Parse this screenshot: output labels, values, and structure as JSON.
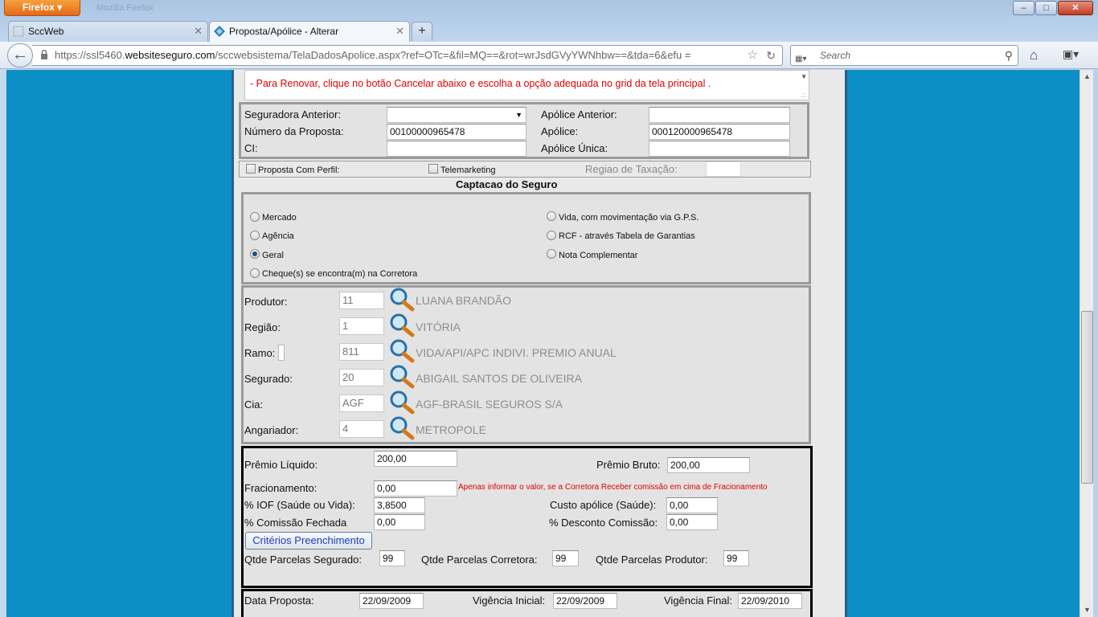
{
  "browser": {
    "app_button": "Firefox",
    "window_title": "Mozilla Firefox",
    "tabs": [
      {
        "label": "SccWeb",
        "active": false
      },
      {
        "label": "Proposta/Apólice - Alterar",
        "active": true
      }
    ],
    "new_tab": "+",
    "url_prefix": "https://ssl5460.",
    "url_domain": "websiteseguro.com",
    "url_path": "/sccwebsistema/TelaDadosApolice.aspx?ref=OTc=&fil=MQ==&rot=wrJsdGVyYWNhbw==&tda=6&efu =",
    "search_placeholder": "Search",
    "window_controls": {
      "minimize": "–",
      "maximize": "□",
      "close": "✕"
    }
  },
  "notice": {
    "text": "- Para Renovar, clique no botão Cancelar abaixo e escolha a opção adequada  no grid da tela principal ."
  },
  "policy": {
    "seguradora_anterior_label": "Seguradora Anterior:",
    "seguradora_anterior_value": "",
    "apolice_anterior_label": "Apólice Anterior:",
    "apolice_anterior_value": "",
    "numero_proposta_label": "Número da Proposta:",
    "numero_proposta_value": "00100000965478",
    "apolice_label": "Apólice:",
    "apolice_value": "000120000965478",
    "ci_label": "CI:",
    "ci_value": "",
    "apolice_unica_label": "Apólice Única:",
    "apolice_unica_value": ""
  },
  "flags": {
    "perfil_label": "Proposta Com Perfil:",
    "perfil_checked": false,
    "telemarketing_label": "Telemarketing",
    "telemarketing_checked": false,
    "regiao_label": "Regiao de Taxação:",
    "regiao_value": ""
  },
  "captacao": {
    "title": "Captacao do Seguro",
    "options": [
      {
        "label": "Mercado",
        "selected": false
      },
      {
        "label": "Agência",
        "selected": false
      },
      {
        "label": "Geral",
        "selected": true
      },
      {
        "label": "Cheque(s) se encontra(m) na Corretora",
        "selected": false
      },
      {
        "label": "Vida, com movimentação via G.P.S.",
        "selected": false
      },
      {
        "label": "RCF - através Tabela de Garantias",
        "selected": false
      },
      {
        "label": "Nota Complementar",
        "selected": false
      }
    ]
  },
  "lookups": [
    {
      "label": "Produtor:",
      "code": "11",
      "name": "LUANA BRANDÃO"
    },
    {
      "label": "Região:",
      "code": "1",
      "name": "VITÓRIA"
    },
    {
      "label": "Ramo:",
      "code": "811",
      "name": "VIDA/API/APC INDIVI. PREMIO ANUAL"
    },
    {
      "label": "Segurado:",
      "code": "20",
      "name": "ABIGAIL SANTOS DE OLIVEIRA"
    },
    {
      "label": "Cia:",
      "code": "AGF",
      "name": "AGF-BRASIL SEGUROS S/A"
    },
    {
      "label": "Angariador:",
      "code": "4",
      "name": "METROPOLE"
    }
  ],
  "premios": {
    "premio_liquido_label": "Prêmio Líquido:",
    "premio_liquido_value": "200,00",
    "premio_bruto_label": "Prêmio Bruto:",
    "premio_bruto_value": "200,00",
    "fracionamento_label": "Fracionamento:",
    "fracionamento_value": "0,00",
    "fracionamento_hint": "Apenas informar o valor, se a Corretora Receber comissão em cima de Fracionamento",
    "iof_label": "% IOF (Saúde ou Vida):",
    "iof_value": "3,8500",
    "custo_label": "Custo apólice (Saúde):",
    "custo_value": "0,00",
    "comissao_label": "% Comissão Fechada",
    "comissao_value": "0,00",
    "desconto_label": "% Desconto Comissão:",
    "desconto_value": "0,00",
    "criterios_button": "Critérios Preenchimento",
    "parcelas_segurado_label": "Qtde Parcelas Segurado:",
    "parcelas_segurado_value": "99",
    "parcelas_corretora_label": "Qtde Parcelas Corretora:",
    "parcelas_corretora_value": "99",
    "parcelas_produtor_label": "Qtde Parcelas Produtor:",
    "parcelas_produtor_value": "99"
  },
  "datas": {
    "data_proposta_label": "Data Proposta:",
    "data_proposta_value": "22/09/2009",
    "vig_inicial_label": "Vigência Inicial:",
    "vig_inicial_value": "22/09/2009",
    "vig_final_label": "Vigência Final:",
    "vig_final_value": "22/09/2010"
  },
  "colors": {
    "accent_red": "#e00000",
    "background_blue": "#0b8fc5"
  }
}
